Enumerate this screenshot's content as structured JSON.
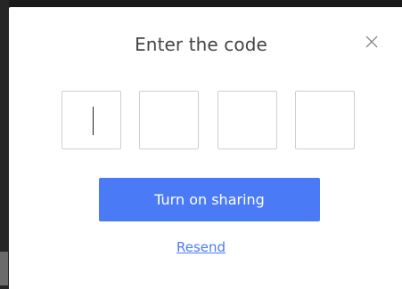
{
  "dialog": {
    "title": "Enter the code",
    "close_icon": "close-icon",
    "code_inputs": [
      {
        "value": ""
      },
      {
        "value": ""
      },
      {
        "value": ""
      },
      {
        "value": ""
      }
    ],
    "primary_button_label": "Turn on sharing",
    "resend_label": "Resend"
  },
  "colors": {
    "accent": "#4a7af6",
    "title_text": "#444444",
    "input_border": "#cfcfcf",
    "backdrop": "#1f1f1f"
  }
}
